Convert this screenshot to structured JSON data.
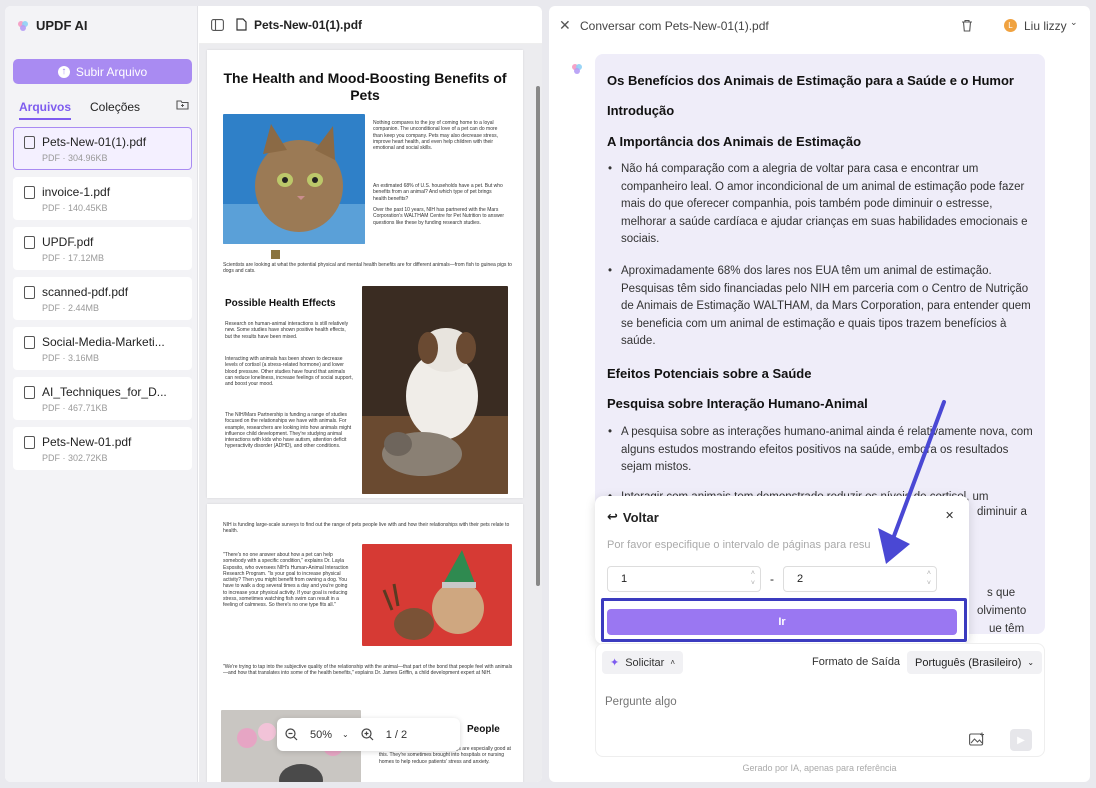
{
  "brand": {
    "name": "UPDF AI"
  },
  "sidebar": {
    "upload_label": "Subir Arquivo",
    "tabs": [
      {
        "label": "Arquivos",
        "active": true
      },
      {
        "label": "Coleções",
        "active": false
      }
    ],
    "files": [
      {
        "name": "Pets-New-01(1).pdf",
        "meta": "PDF · 304.96KB",
        "selected": true
      },
      {
        "name": "invoice-1.pdf",
        "meta": "PDF · 140.45KB"
      },
      {
        "name": "UPDF.pdf",
        "meta": "PDF · 17.12MB"
      },
      {
        "name": "scanned-pdf.pdf",
        "meta": "PDF · 2.44MB"
      },
      {
        "name": "Social-Media-Marketi...",
        "meta": "PDF · 3.16MB"
      },
      {
        "name": "AI_Techniques_for_D...",
        "meta": "PDF · 467.71KB"
      },
      {
        "name": "Pets-New-01.pdf",
        "meta": "PDF · 302.72KB"
      }
    ]
  },
  "doc": {
    "title": "Pets-New-01(1).pdf",
    "page1": {
      "title": "The Health and Mood-Boosting Benefits of Pets",
      "intro": "Nothing compares to the joy of coming home to a loyal companion. The unconditional love of a pet can do more than keep you company. Pets may also decrease stress, improve heart health, and even help children with their emotional and social skills.",
      "intro2": "An estimated 68% of U.S. households have a pet. But who benefits from an animal? And which type of pet brings health benefits?",
      "intro3": "Over the past 10 years, NIH has partnered with the Mars Corporation's WALTHAM Centre for Pet Nutrition to answer questions like these by funding research studies.",
      "caption": "Scientists are looking at what the potential physical and mental health benefits are for different animals—from fish to guinea pigs to dogs and cats.",
      "h_effects": "Possible Health Effects",
      "effects1": "Research on human-animal interactions is still relatively new. Some studies have shown positive health effects, but the results have been mixed.",
      "effects2": "Interacting with animals has been shown to decrease levels of cortisol (a stress-related hormone) and lower blood pressure. Other studies have found that animals can reduce loneliness, increase feelings of social support, and boost your mood.",
      "effects3": "The NIH/Mars Partnership is funding a range of studies focused on the relationships we have with animals. For example, researchers are looking into how animals might influence child development. They're studying animal interactions with kids who have autism, attention deficit hyperactivity disorder (ADHD), and other conditions."
    },
    "page2": {
      "p1": "NIH is funding large-scale surveys to find out the range of pets people live with and how their relationships with their pets relate to health.",
      "quote1": "\"There's no one answer about how a pet can help somebody with a specific condition,\" explains Dr. Layla Esposito, who oversees NIH's Human-Animal Interaction Research Program. \"Is your goal to increase physical activity? Then you might benefit from owning a dog. You have to walk a dog several times a day and you're going to increase your physical activity. If your goal is reducing stress, sometimes watching fish swim can result in a feeling of calmness. So there's no one type fits all.\"",
      "quote2": "\"We're trying to tap into the subjective quality of the relationship with the animal—that part of the bond that people feel with animals—and how that translates into some of the health benefits,\" explains Dr. James Griffin, a child development expert at NIH.",
      "h_people": "People",
      "people": "...comfort and support. Therapy dogs are especially good at this. They're sometimes brought into hospitals or nursing homes to help reduce patients' stress and anxiety."
    },
    "zoom": "50%",
    "page_indicator": "1 / 2"
  },
  "chat": {
    "title": "Conversar com Pets-New-01(1).pdf",
    "user": "Liu lizzy",
    "user_initial": "L",
    "message": {
      "title": "Os Benefícios dos Animais de Estimação para a Saúde e o Humor",
      "h_intro": "Introdução",
      "h_importance": "A Importância dos Animais de Estimação",
      "b1": "Não há comparação com a alegria de voltar para casa e encontrar um companheiro leal. O amor incondicional de um animal de estimação pode fazer mais do que oferecer companhia, pois também pode diminuir o estresse, melhorar a saúde cardíaca e ajudar crianças em suas habilidades emocionais e sociais.",
      "b2": "Aproximadamente 68% dos lares nos EUA têm um animal de estimação. Pesquisas têm sido financiadas pelo NIH em parceria com o Centro de Nutrição de Animais de Estimação WALTHAM, da Mars Corporation, para entender quem se beneficia com um animal de estimação e quais tipos trazem benefícios à saúde.",
      "h_effects": "Efeitos Potenciais sobre a Saúde",
      "h_research": "Pesquisa sobre Interação Humano-Animal",
      "b3": "A pesquisa sobre as interações humano-animal ainda é relativamente nova, com alguns estudos mostrando efeitos positivos na saúde, embora os resultados sejam mistos.",
      "b4": "Interagir com animais tem demonstrado reduzir os níveis de cortisol, um",
      "b4_tail": "diminuir a",
      "b5_t1": "s que",
      "b5_t2": "olvimento",
      "b5_t3": "ue têm"
    },
    "popup": {
      "back": "Voltar",
      "hint": "Por favor especifique o intervalo de páginas para resu",
      "from": "1",
      "to": "2",
      "dash": "-",
      "go": "Ir"
    },
    "composer": {
      "prompt_label": "Solicitar",
      "format_label": "Formato de Saída",
      "language": "Português (Brasileiro)",
      "placeholder": "Pergunte algo"
    },
    "footnote": "Gerado por IA, apenas para referência"
  },
  "colors": {
    "accent": "#9a77f2",
    "highlight": "#3b3bbf",
    "arrow": "#4a48d4"
  }
}
